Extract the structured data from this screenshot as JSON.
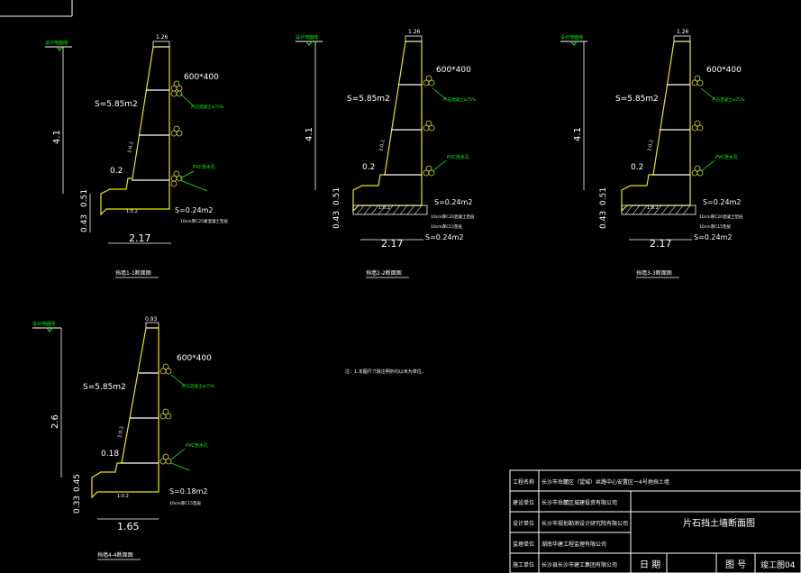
{
  "colors": {
    "background": "#000000",
    "wall": "#e8e800",
    "leader": "#00e000",
    "dim": "#ffffff",
    "pipe": "#d8d830",
    "title_block_border": "#ffffff"
  },
  "sections": [
    {
      "caption": "挡墙1-1断面图",
      "height_dim": "4.1",
      "top_width": "1.26",
      "base_width": "2.17",
      "toe_height": "0.51",
      "toe_base": "0.43",
      "step_dim": "0.2",
      "area_upper": "S=5.85m2",
      "area_lower": "S=0.24m2",
      "pipe_size": "600*400",
      "grade_label": "设计地面线",
      "slope_label": "1:0.2",
      "base_slope": "1:0.2",
      "note_blocks": "片石混凝土≥75%",
      "note_drain": "PVC泄水孔",
      "note_base": "10cm厚C25素混凝土垫层"
    },
    {
      "caption": "挡墙2-2断面图",
      "height_dim": "4.1",
      "top_width": "1.26",
      "base_width": "2.17",
      "toe_height": "0.51",
      "toe_base": "0.43",
      "step_dim": "0.2",
      "area_upper": "S=5.85m2",
      "area_lower": "S=0.24m2",
      "area_lower2": "S=0.24m2",
      "pipe_size": "600*400",
      "grade_label": "设计地面线",
      "slope_label": "1:0.2",
      "base_slope": "1:0.2",
      "note_blocks": "片石混凝土≥75%",
      "note_drain": "PVC泄水孔",
      "note_fill": "10cm厚C15垫层",
      "note_base": "10cm厚C20混凝土垫层"
    },
    {
      "caption": "挡墙3-3断面图",
      "height_dim": "4.1",
      "top_width": "1.26",
      "base_width": "2.17",
      "toe_height": "0.51",
      "toe_base": "0.43",
      "step_dim": "0.2",
      "area_upper": "S=5.85m2",
      "area_lower": "S=0.24m2",
      "area_lower2": "S=0.24m2",
      "pipe_size": "600*400",
      "grade_label": "设计地面线",
      "slope_label": "1:0.2",
      "base_slope": "1:0.2",
      "note_blocks": "片石混凝土≥75%",
      "note_drain": "PVC泄水孔",
      "note_fill": "10cm厚C15垫层",
      "note_base": "10cm厚C20混凝土垫层"
    },
    {
      "caption": "挡墙4-4断面图",
      "height_dim": "2.6",
      "top_width": "0.93",
      "base_width": "1.65",
      "toe_height": "0.45",
      "toe_base": "0.33",
      "step_dim": "0.18",
      "area_upper": "S=5.85m2",
      "area_lower": "S=0.18m2",
      "pipe_size": "600*400",
      "grade_label": "设计地面线",
      "slope_label": "1:0.2",
      "base_slope": "1:0.2",
      "note_blocks": "片石混凝土≥75%",
      "note_drain": "PVC泄水孔",
      "note_base": "10cm厚C15垫层"
    }
  ],
  "note": "注：1.本图尺寸除注明外均以米为单位。",
  "title_block": {
    "rows": [
      {
        "label": "工程名称",
        "value": "长沙市岳麓区（望城）丝路中心安置区一4号地挡土墙"
      },
      {
        "label": "建设单位",
        "value": "长沙市岳麓区城建投资有限公司"
      },
      {
        "label": "设计单位",
        "value": "长沙市规划勘测设计研究院有限公司"
      },
      {
        "label": "监理单位",
        "value": "湖南华建工程监理有限公司"
      },
      {
        "label": "施工单位",
        "value": "长沙县长沙市建工集团有限公司"
      }
    ],
    "drawing_title": "片石挡土墙断面图",
    "date_label": "日 期",
    "number_label": "图 号",
    "number_value": "竣工图04"
  }
}
